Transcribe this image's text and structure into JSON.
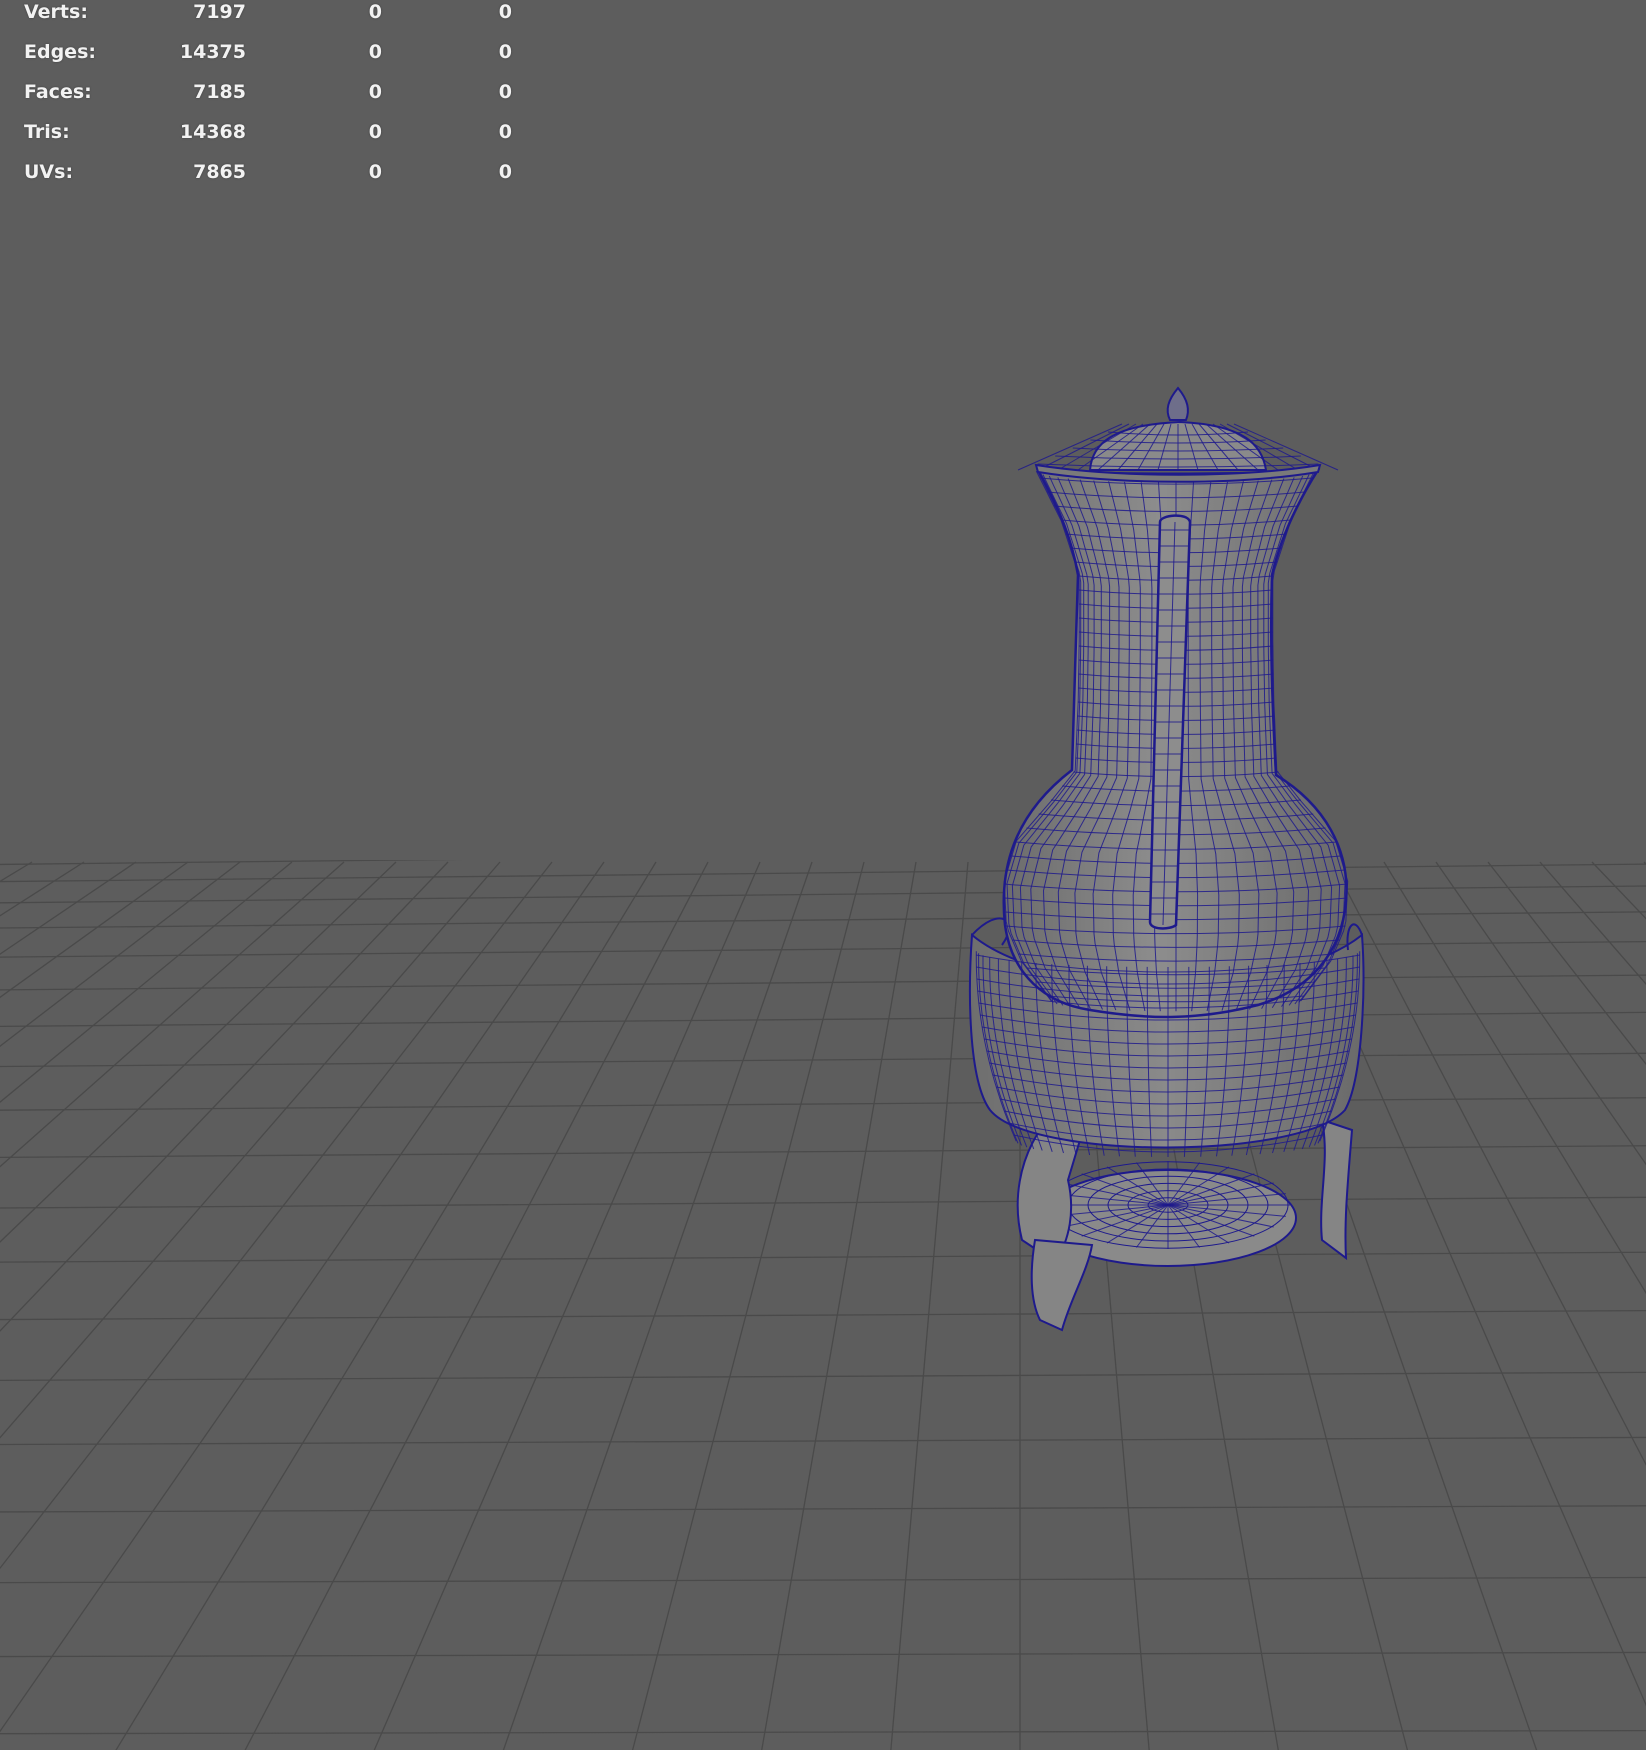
{
  "app": {
    "view": "3D viewport (perspective)",
    "background_color": "#5d5d5d",
    "wireframe_color": "#1e1a8c",
    "grid_color": "#4a4a4a"
  },
  "heads_up_display": {
    "rows": [
      {
        "label": "Verts:",
        "total": "7197",
        "selected": "0",
        "components": "0"
      },
      {
        "label": "Edges:",
        "total": "14375",
        "selected": "0",
        "components": "0"
      },
      {
        "label": "Faces:",
        "total": "7185",
        "selected": "0",
        "components": "0"
      },
      {
        "label": "Tris:",
        "total": "14368",
        "selected": "0",
        "components": "0"
      },
      {
        "label": "UVs:",
        "total": "7865",
        "selected": "0",
        "components": "0"
      }
    ]
  },
  "model": {
    "name": "coffee-pot-on-stand",
    "display_mode": "wireframe-on-shaded"
  }
}
